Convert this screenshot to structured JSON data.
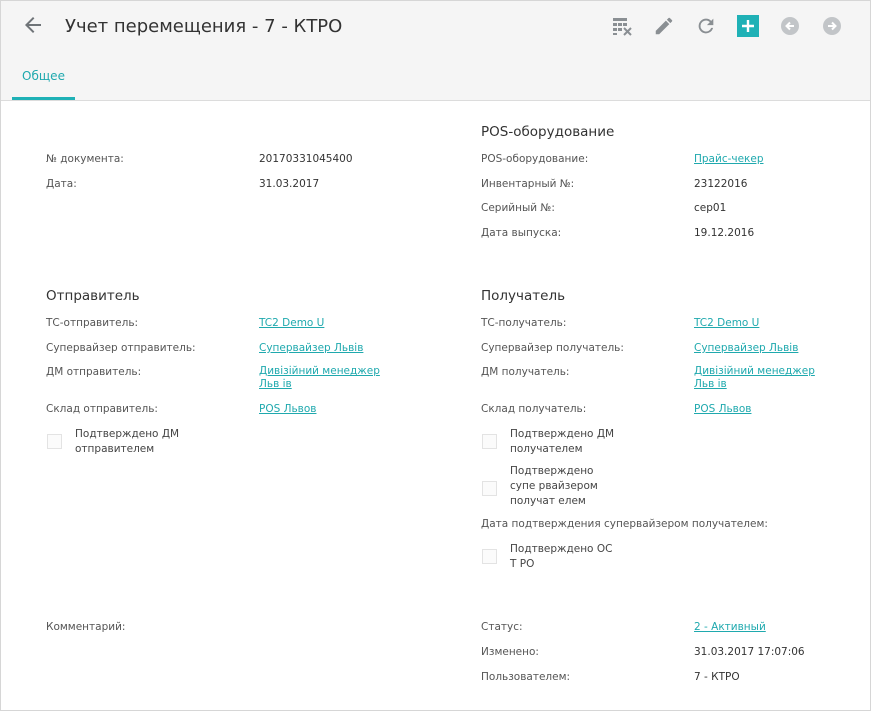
{
  "header": {
    "title": "Учет перемещения - 7 - КТРО"
  },
  "tabs": [
    {
      "label": "Общее"
    }
  ],
  "document": {
    "doc_number_label": "№ документа:",
    "doc_number_value": "20170331045400",
    "date_label": "Дата:",
    "date_value": "31.03.2017"
  },
  "pos": {
    "header": "POS-оборудование",
    "equipment_label": "POS-оборудование:",
    "equipment_value": "Прайс-чекер",
    "inventory_label": "Инвентарный №:",
    "inventory_value": "23122016",
    "serial_label": "Серийный №:",
    "serial_value": "сер01",
    "release_label": "Дата выпуска:",
    "release_value": "19.12.2016"
  },
  "sender": {
    "header": "Отправитель",
    "ts_label": "ТС-отправитель:",
    "ts_value": "TC2 Demo U",
    "supervisor_label": "Супервайзер отправитель:",
    "supervisor_value": "Супервайзер Львів",
    "dm_label": "ДМ отправитель:",
    "dm_value": "Дивізійний менеджер Льв ів",
    "warehouse_label": "Склад отправитель:",
    "warehouse_value": "POS Львов",
    "confirmed_dm": "Подтверждено ДМ отправителем"
  },
  "receiver": {
    "header": "Получатель",
    "ts_label": "ТС-получатель:",
    "ts_value": "TC2 Demo U",
    "supervisor_label": "Супервайзер получатель:",
    "supervisor_value": "Супервайзер Львів",
    "dm_label": "ДМ получатель:",
    "dm_value": "Дивізійний менеджер Льв ів",
    "warehouse_label": "Склад получатель:",
    "warehouse_value": "POS Львов",
    "confirmed_dm": "Подтверждено ДМ получателем",
    "confirmed_supervisor": "Подтверждено супе рвайзером получат елем",
    "confirm_date_label": "Дата подтверждения супервайзером получателем:",
    "confirmed_ocpo": "Подтверждено ОС Т РО"
  },
  "footer": {
    "comment_label": "Комментарий:",
    "status_label": "Статус:",
    "status_value": "2 - Активный",
    "modified_label": "Изменено:",
    "modified_value": "31.03.2017 17:07:06",
    "user_label": "Пользователем:",
    "user_value": "7 - КТРО"
  },
  "colors": {
    "accent": "#1fb1b6",
    "link": "#1fa9ae",
    "header_bg": "#f5f5f5"
  },
  "icons": {
    "back": "arrow-left-icon",
    "columns": "table-columns-icon",
    "edit": "pencil-icon",
    "refresh": "refresh-icon",
    "add": "plus-icon",
    "prev": "circle-arrow-left-icon",
    "next": "circle-arrow-right-icon"
  }
}
